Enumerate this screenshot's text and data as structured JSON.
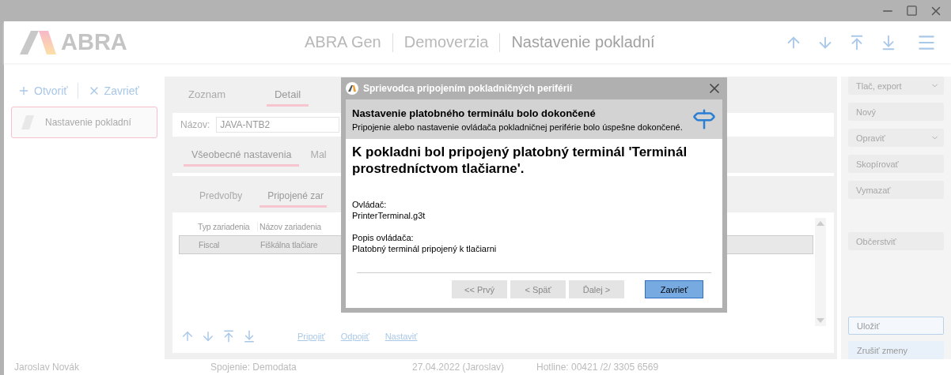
{
  "header": {
    "logo": "ABRA",
    "breadcrumb": [
      "ABRA Gen",
      "Demoverzia",
      "Nastavenie pokladní"
    ]
  },
  "left_panel": {
    "actions": [
      {
        "kind": "add",
        "label": "Otvoriť"
      },
      {
        "kind": "close",
        "label": "Zavrieť"
      }
    ],
    "items": [
      {
        "label": "Nastavenie pokladní",
        "selected": true
      }
    ]
  },
  "detail": {
    "tabs": [
      {
        "label": "Zoznam",
        "selected": false
      },
      {
        "label": "Detail",
        "selected": true
      }
    ],
    "name_field": {
      "label": "Názov:",
      "value": "JAVA-NTB2"
    },
    "section_tabs": [
      {
        "label": "Všeobecné nastavenia",
        "selected": true
      },
      {
        "label": "Mal",
        "selected": false
      }
    ],
    "sub_tabs": [
      {
        "label": "Predvoľby",
        "selected": false
      },
      {
        "label": "Pripojené zar",
        "selected": true
      }
    ],
    "table": {
      "columns": [
        "Typ zariadenia",
        "Názov zariadenia"
      ],
      "rows": [
        {
          "cells": [
            "Fiscal",
            "Fiškálna tlačiare"
          ],
          "selected": true
        }
      ]
    },
    "links": [
      "Pripojiť",
      "Odpojiť",
      "Nastaviť"
    ]
  },
  "actions": [
    {
      "label": "Tlač, export",
      "dropdown": true,
      "spaced": false
    },
    {
      "label": "Nový",
      "dropdown": false,
      "spaced": false
    },
    {
      "label": "Opraviť",
      "dropdown": true,
      "spaced": false
    },
    {
      "label": "Skopírovať",
      "dropdown": false,
      "spaced": false
    },
    {
      "label": "Vymazať",
      "dropdown": false,
      "spaced": false
    },
    {
      "label": "Občerstviť",
      "dropdown": false,
      "spaced": true
    }
  ],
  "save_actions": [
    {
      "label": "Uložiť",
      "kind": "outlined"
    },
    {
      "label": "Zrušiť zmeny",
      "kind": "tinted"
    }
  ],
  "status_bar": [
    "Jaroslav Novák",
    "Spojenie: Demodata",
    "27.04.2022 (Jaroslav)",
    "Hotline: 00421 /2/ 3305 6569"
  ],
  "dialog": {
    "title": "Sprievodca pripojením pokladničných periférií",
    "step_title": "Nastavenie platobného terminálu bolo dokončené",
    "step_subtitle": "Pripojenie alebo nastavenie ovládača pokladničnej periférie bolo úspešne dokončené.",
    "heading": "K pokladni bol pripojený platobný terminál 'Terminál prostredníctvom tlačiarne'.",
    "details": [
      {
        "label": "Ovládač:",
        "value": "PrinterTerminal.g3t"
      },
      {
        "label": "Popis ovládača:",
        "value": "Platobný terminál pripojený k tlačiarni"
      }
    ],
    "buttons": [
      {
        "label": "<< Prvý",
        "disabled": true,
        "default": false
      },
      {
        "label": "< Späť",
        "disabled": true,
        "default": false
      },
      {
        "label": "Ďalej >",
        "disabled": true,
        "default": false
      },
      {
        "label": "Zavrieť",
        "disabled": false,
        "default": true
      }
    ]
  }
}
